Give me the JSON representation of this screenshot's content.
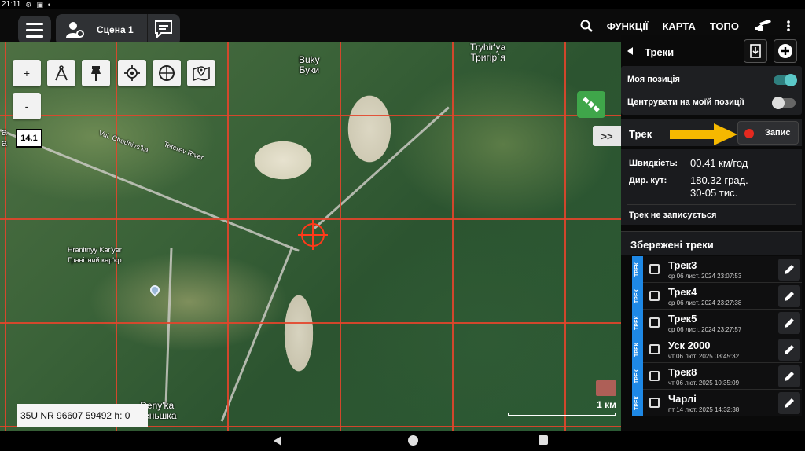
{
  "status_bar": {
    "time": "21:11"
  },
  "topbar": {
    "scene_label": "Сцена 1",
    "menu": [
      "ФУНКЦІЇ",
      "КАРТА",
      "ТОПО"
    ]
  },
  "map": {
    "zoom_level": "14.1",
    "zoom_in": "+",
    "zoom_out": "-",
    "collapse_label": ">>",
    "coordinates": "35U NR 96607 59492 h: 0",
    "scale_label": "1 км",
    "labels": {
      "buky_lat": "Buky",
      "buky_cyr": "Буки",
      "tryhirya_lat": "Tryhir'ya",
      "tryhirya_cyr": "Тригір`я",
      "teteriv_river": "Teterev River",
      "vul_chudnivs": "Vul. Chudnivs'ka",
      "hranitnyy_lat": "Hranitnyy Kar'yer",
      "hranitnyy_cyr": "Гранітний кар'єр",
      "denyshi_lat": "Deny'ka",
      "denyshi_cyr": "Деньшка",
      "left_edge_top": "a",
      "left_edge_bottom": "a"
    }
  },
  "panel": {
    "title": "Треки",
    "options": {
      "my_position": "Моя позиція",
      "center_on_me": "Центрувати на моїй позиції"
    },
    "track_section": {
      "label": "Трек",
      "record_label": "Запис"
    },
    "stats": {
      "speed_label": "Швидкість:",
      "speed_value": "00.41 км/год",
      "dir_label": "Дир. кут:",
      "dir_value_deg": "180.32 град.",
      "dir_value_mil": "30-05 тис.",
      "status": "Трек не записується"
    },
    "saved_title": "Збережені треки",
    "tracks": [
      {
        "tag": "ТРЕК",
        "name": "Трек3",
        "date": "ср 06 лист. 2024 23:07:53"
      },
      {
        "tag": "ТРЕК",
        "name": "Трек4",
        "date": "ср 06 лист. 2024 23:27:38"
      },
      {
        "tag": "ТРЕК",
        "name": "Трек5",
        "date": "ср 06 лист. 2024 23:27:57"
      },
      {
        "tag": "ТРЕК",
        "name": "Уск 2000",
        "date": "чт 06 лют. 2025 08:45:32"
      },
      {
        "tag": "ТРЕК",
        "name": "Трек8",
        "date": "чт 06 лют. 2025 10:35:09"
      },
      {
        "tag": "ТРЕК",
        "name": "Чарлі",
        "date": "пт 14 лют. 2025 14:32:38"
      }
    ]
  },
  "colors": {
    "accent_toggle": "#5bc8c8",
    "record_dot": "#e5291f",
    "grid": "#e3452b",
    "track_tag": "#1e88e5",
    "arrow": "#f5b800"
  }
}
